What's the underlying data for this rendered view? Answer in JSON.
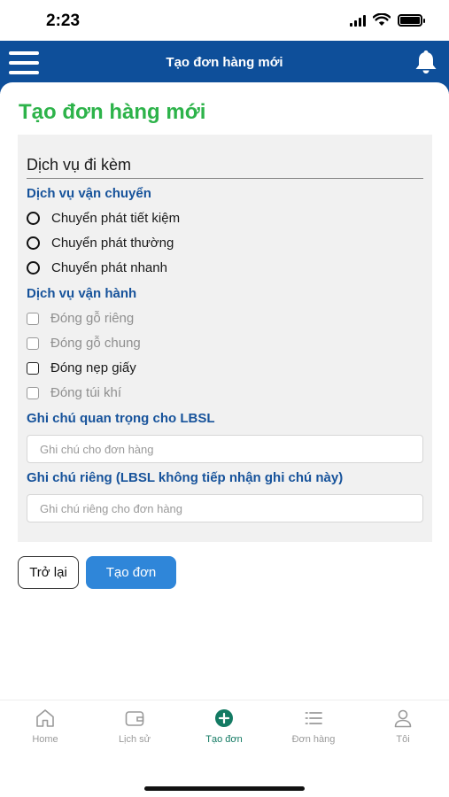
{
  "status_bar": {
    "time": "2:23"
  },
  "header": {
    "title": "Tạo đơn hàng mới"
  },
  "page": {
    "title": "Tạo đơn hàng mới"
  },
  "form": {
    "section_title": "Dịch vụ đi kèm",
    "shipping": {
      "label": "Dịch vụ vận chuyển",
      "options": [
        "Chuyển phát tiết kiệm",
        "Chuyển phát thường",
        "Chuyển phát nhanh"
      ]
    },
    "operations": {
      "label": "Dịch vụ vận hành",
      "options": [
        "Đóng gỗ riêng",
        "Đóng gỗ chung",
        "Đóng nẹp giấy",
        "Đóng túi khí"
      ]
    },
    "note_important": {
      "label": "Ghi chú quan trọng cho LBSL",
      "placeholder": "Ghi chú cho đơn hàng",
      "value": ""
    },
    "note_private": {
      "label": "Ghi chú riêng (LBSL không tiếp nhận ghi chú này)",
      "placeholder": "Ghi chú riêng cho đơn hàng",
      "value": ""
    }
  },
  "buttons": {
    "back": "Trở lại",
    "create": "Tạo đơn"
  },
  "tabs": [
    {
      "label": "Home",
      "icon": "home-icon"
    },
    {
      "label": "Lịch sử",
      "icon": "wallet-icon"
    },
    {
      "label": "Tạo đơn",
      "icon": "plus-circle-icon",
      "active": true
    },
    {
      "label": "Đơn hàng",
      "icon": "list-icon"
    },
    {
      "label": "Tôi",
      "icon": "user-icon"
    }
  ],
  "colors": {
    "header": "#0e4f9a",
    "title_green": "#2db34a",
    "section_blue": "#17539b",
    "primary_button": "#2f86d9",
    "active_tab": "#137a63"
  }
}
